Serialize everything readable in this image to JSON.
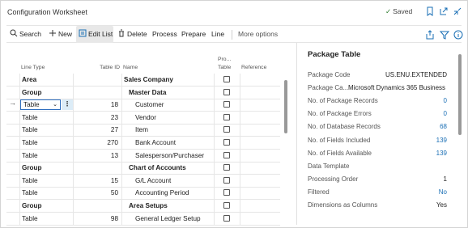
{
  "window": {
    "title": "Configuration Worksheet",
    "saved_label": "Saved"
  },
  "actions": {
    "search": "Search",
    "new": "New",
    "edit_list": "Edit List",
    "delete": "Delete",
    "process": "Process",
    "prepare": "Prepare",
    "line": "Line",
    "more": "More options"
  },
  "grid": {
    "columns": {
      "line_type": "Line Type",
      "table_id": "Table ID",
      "name": "Name",
      "pro_1": "Pro...",
      "pro_2": "Table",
      "reference": "Reference"
    },
    "rows": [
      {
        "line_type": "Area",
        "table_id": "",
        "name": "Sales Company",
        "bold": true
      },
      {
        "line_type": "Group",
        "table_id": "",
        "name": "Master Data",
        "bold": true
      },
      {
        "line_type": "Table",
        "table_id": "18",
        "name": "Customer",
        "bold": false
      },
      {
        "line_type": "Table",
        "table_id": "23",
        "name": "Vendor",
        "bold": false
      },
      {
        "line_type": "Table",
        "table_id": "27",
        "name": "Item",
        "bold": false
      },
      {
        "line_type": "Table",
        "table_id": "270",
        "name": "Bank Account",
        "bold": false
      },
      {
        "line_type": "Table",
        "table_id": "13",
        "name": "Salesperson/Purchaser",
        "bold": false
      },
      {
        "line_type": "Group",
        "table_id": "",
        "name": "Chart of Accounts",
        "bold": true
      },
      {
        "line_type": "Table",
        "table_id": "15",
        "name": "G/L Account",
        "bold": false
      },
      {
        "line_type": "Table",
        "table_id": "50",
        "name": "Accounting Period",
        "bold": false
      },
      {
        "line_type": "Group",
        "table_id": "",
        "name": "Area Setups",
        "bold": true
      },
      {
        "line_type": "Table",
        "table_id": "98",
        "name": "General Ledger Setup",
        "bold": false
      }
    ]
  },
  "factbox": {
    "title": "Package Table",
    "fields": [
      {
        "label": "Package Code",
        "value": "US.ENU.EXTENDED",
        "link": false
      },
      {
        "label": "Package Ca...",
        "value": "Microsoft Dynamics 365 Business ...",
        "link": false
      },
      {
        "label": "No. of Package Records",
        "value": "0",
        "link": true
      },
      {
        "label": "No. of Package Errors",
        "value": "0",
        "link": true
      },
      {
        "label": "No. of Database Records",
        "value": "68",
        "link": true
      },
      {
        "label": "No. of Fields Included",
        "value": "139",
        "link": true
      },
      {
        "label": "No. of Fields Available",
        "value": "139",
        "link": true
      },
      {
        "label": "Data Template",
        "value": "",
        "link": false
      },
      {
        "label": "Processing Order",
        "value": "1",
        "link": false
      },
      {
        "label": "Filtered",
        "value": "No",
        "link": true
      },
      {
        "label": "Dimensions as Columns",
        "value": "Yes",
        "link": false
      }
    ]
  }
}
